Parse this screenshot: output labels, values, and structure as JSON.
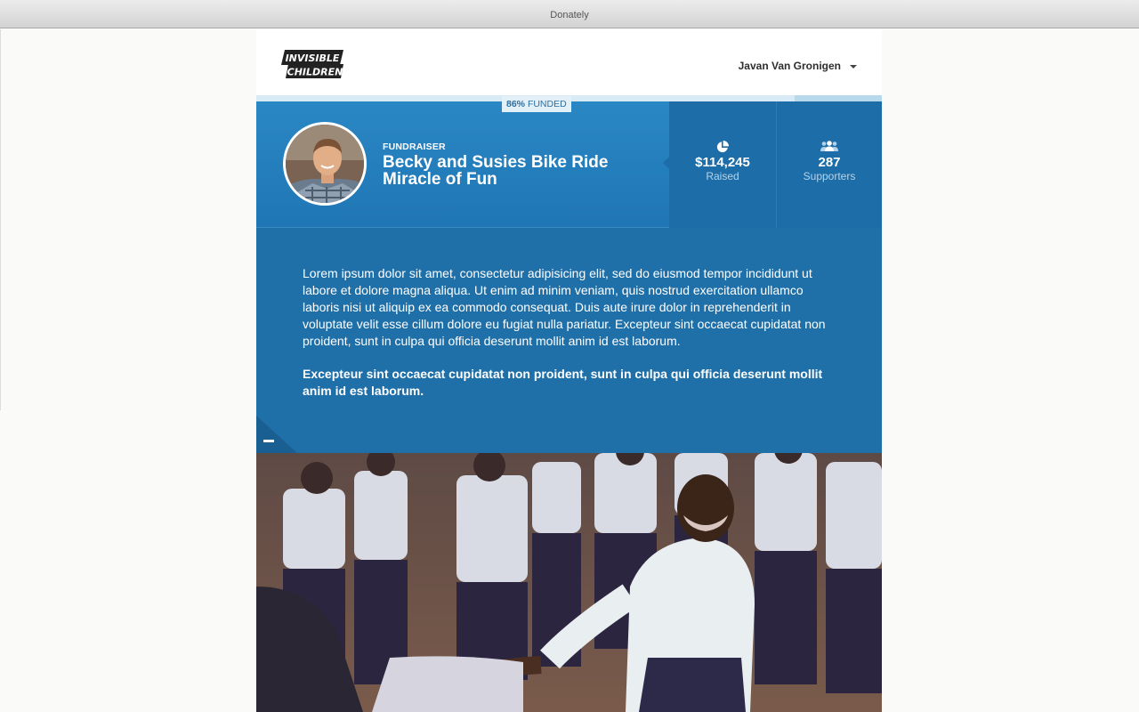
{
  "window": {
    "title": "Donately"
  },
  "header": {
    "logo_line1": "INVISIBLE",
    "logo_line2": "CHILDREN",
    "user_name": "Javan Van Gronigen"
  },
  "progress": {
    "funded_percent": 86,
    "percent_label": "86%",
    "funded_label": "FUNDED"
  },
  "fundraiser": {
    "eyebrow": "FUNDRAISER",
    "title_line1": "Becky and Susies Bike Ride",
    "title_line2": "Miracle of Fun"
  },
  "stats": {
    "raised": {
      "value": "$114,245",
      "label": "Raised",
      "icon": "pie-chart-icon"
    },
    "supporters": {
      "value": "287",
      "label": "Supporters",
      "icon": "people-icon"
    }
  },
  "description": {
    "paragraph": "Lorem ipsum dolor sit amet, consectetur adipisicing elit, sed do eiusmod tempor incididunt ut labore et dolore magna aliqua. Ut enim ad minim veniam, quis nostrud exercitation ullamco laboris nisi ut aliquip ex ea commodo consequat. Duis aute irure dolor in reprehenderit in voluptate velit esse cillum dolore eu fugiat nulla pariatur. Excepteur sint occaecat cupidatat non proident, sunt in culpa qui officia deserunt mollit anim id est laborum.",
    "bold_paragraph": "Excepteur sint occaecat cupidatat non proident, sunt in culpa qui officia deserunt mollit anim id est laborum."
  },
  "colors": {
    "hero_blue": "#2a87c4",
    "stat_blue": "#1d6ea8",
    "body_blue": "#1f6fa8",
    "badge_text": "#2a6f9f"
  }
}
